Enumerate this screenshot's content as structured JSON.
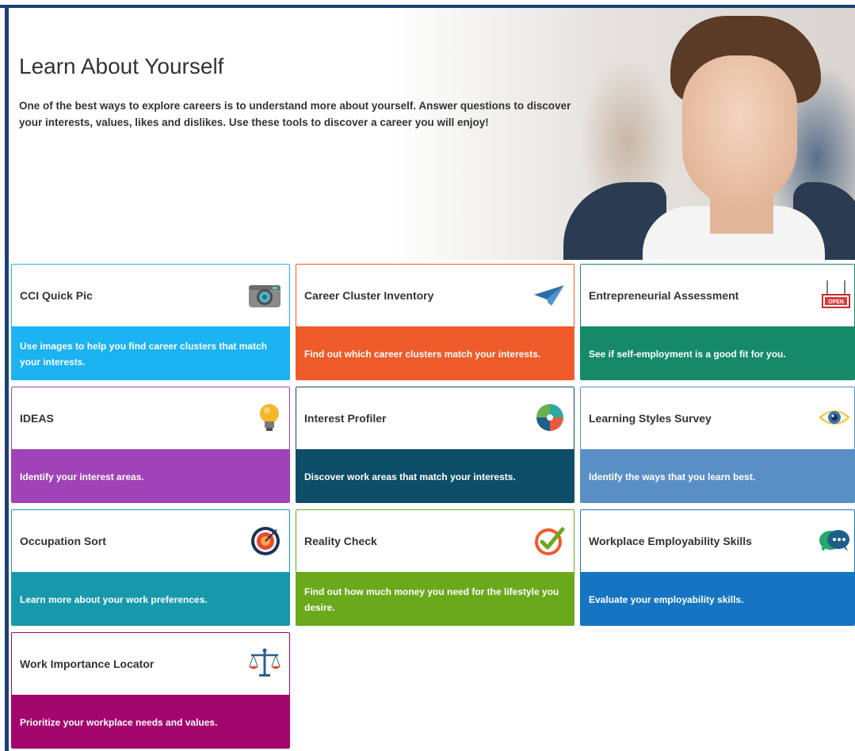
{
  "hero": {
    "title": "Learn About Yourself",
    "description": "One of the best ways to explore careers is to understand more about yourself. Answer questions to discover your interests, values, likes and dislikes. Use these tools to discover a career you will enjoy!"
  },
  "cards": [
    {
      "title": "CCI Quick Pic",
      "description": "Use images to help you find career clusters that match your interests.",
      "icon": "camera-icon",
      "color": "#1cb3f2"
    },
    {
      "title": "Career Cluster Inventory",
      "description": "Find out which career clusters match your interests.",
      "icon": "paper-plane-icon",
      "color": "#ef5b2a"
    },
    {
      "title": "Entrepreneurial Assessment",
      "description": "See if self-employment is a good fit for you.",
      "icon": "open-sign-icon",
      "color": "#168a68"
    },
    {
      "title": "IDEAS",
      "description": "Identify your interest areas.",
      "icon": "lightbulb-icon",
      "color": "#a043b6"
    },
    {
      "title": "Interest Profiler",
      "description": "Discover work areas that match your interests.",
      "icon": "puzzle-globe-icon",
      "color": "#0e4d68"
    },
    {
      "title": "Learning Styles Survey",
      "description": "Identify the ways that you learn best.",
      "icon": "eye-icon",
      "color": "#5a8fc6"
    },
    {
      "title": "Occupation Sort",
      "description": "Learn more about your work preferences.",
      "icon": "target-icon",
      "color": "#1799ab"
    },
    {
      "title": "Reality Check",
      "description": "Find out how much money you need for the lifestyle you desire.",
      "icon": "checkmark-circle-icon",
      "color": "#6aa91c"
    },
    {
      "title": "Workplace Employability Skills",
      "description": "Evaluate your employability skills.",
      "icon": "speech-bubbles-icon",
      "color": "#1575c2"
    },
    {
      "title": "Work Importance Locator",
      "description": "Prioritize your workplace needs and values.",
      "icon": "balance-scale-icon",
      "color": "#a3066c"
    }
  ]
}
